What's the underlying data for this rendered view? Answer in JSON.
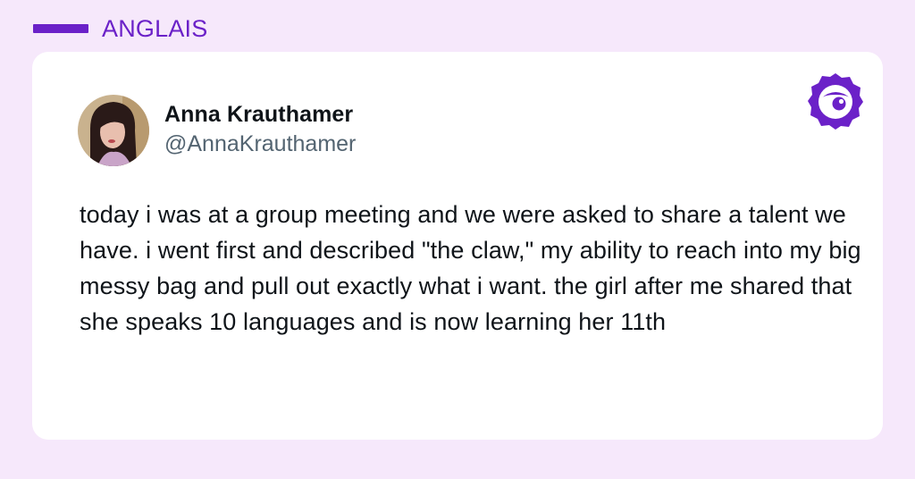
{
  "header": {
    "label": "ANGLAIS"
  },
  "tweet": {
    "author": {
      "name": "Anna Krauthamer",
      "handle": "@AnnaKrauthamer"
    },
    "text": "today i was at a group meeting and we were asked to share a talent we have. i went first and described \"the claw,\" my ability to reach into my big messy bag and pull out exactly what i want. the girl after me shared that she speaks 10 languages and is now learning her 11th"
  },
  "icons": {
    "brand": "brand-logo-icon"
  },
  "colors": {
    "background": "#f6e8fb",
    "accent": "#6b21c8",
    "card": "#ffffff",
    "text": "#0f1419",
    "muted": "#536471"
  }
}
